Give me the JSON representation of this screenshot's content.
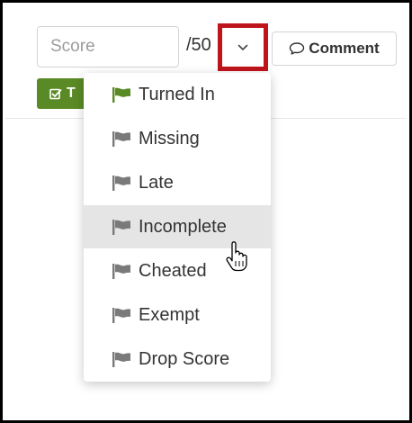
{
  "score": {
    "placeholder": "Score",
    "value": "",
    "out_of": "/50"
  },
  "dropdown_toggle": {
    "icon": "chevron-down-icon"
  },
  "comment_button": {
    "label": "Comment",
    "icon": "speech-bubble-icon"
  },
  "status_button": {
    "label": "T",
    "icon": "checkbox-icon",
    "color": "#5a8a25"
  },
  "status_menu": {
    "items": [
      {
        "label": "Turned In",
        "flag_color": "#5a8a25"
      },
      {
        "label": "Missing",
        "flag_color": "#7a7a7a"
      },
      {
        "label": "Late",
        "flag_color": "#7a7a7a"
      },
      {
        "label": "Incomplete",
        "flag_color": "#7a7a7a",
        "hovered": true
      },
      {
        "label": "Cheated",
        "flag_color": "#7a7a7a"
      },
      {
        "label": "Exempt",
        "flag_color": "#7a7a7a"
      },
      {
        "label": "Drop Score",
        "flag_color": "#7a7a7a"
      }
    ]
  },
  "highlight_color": "#c0141c"
}
